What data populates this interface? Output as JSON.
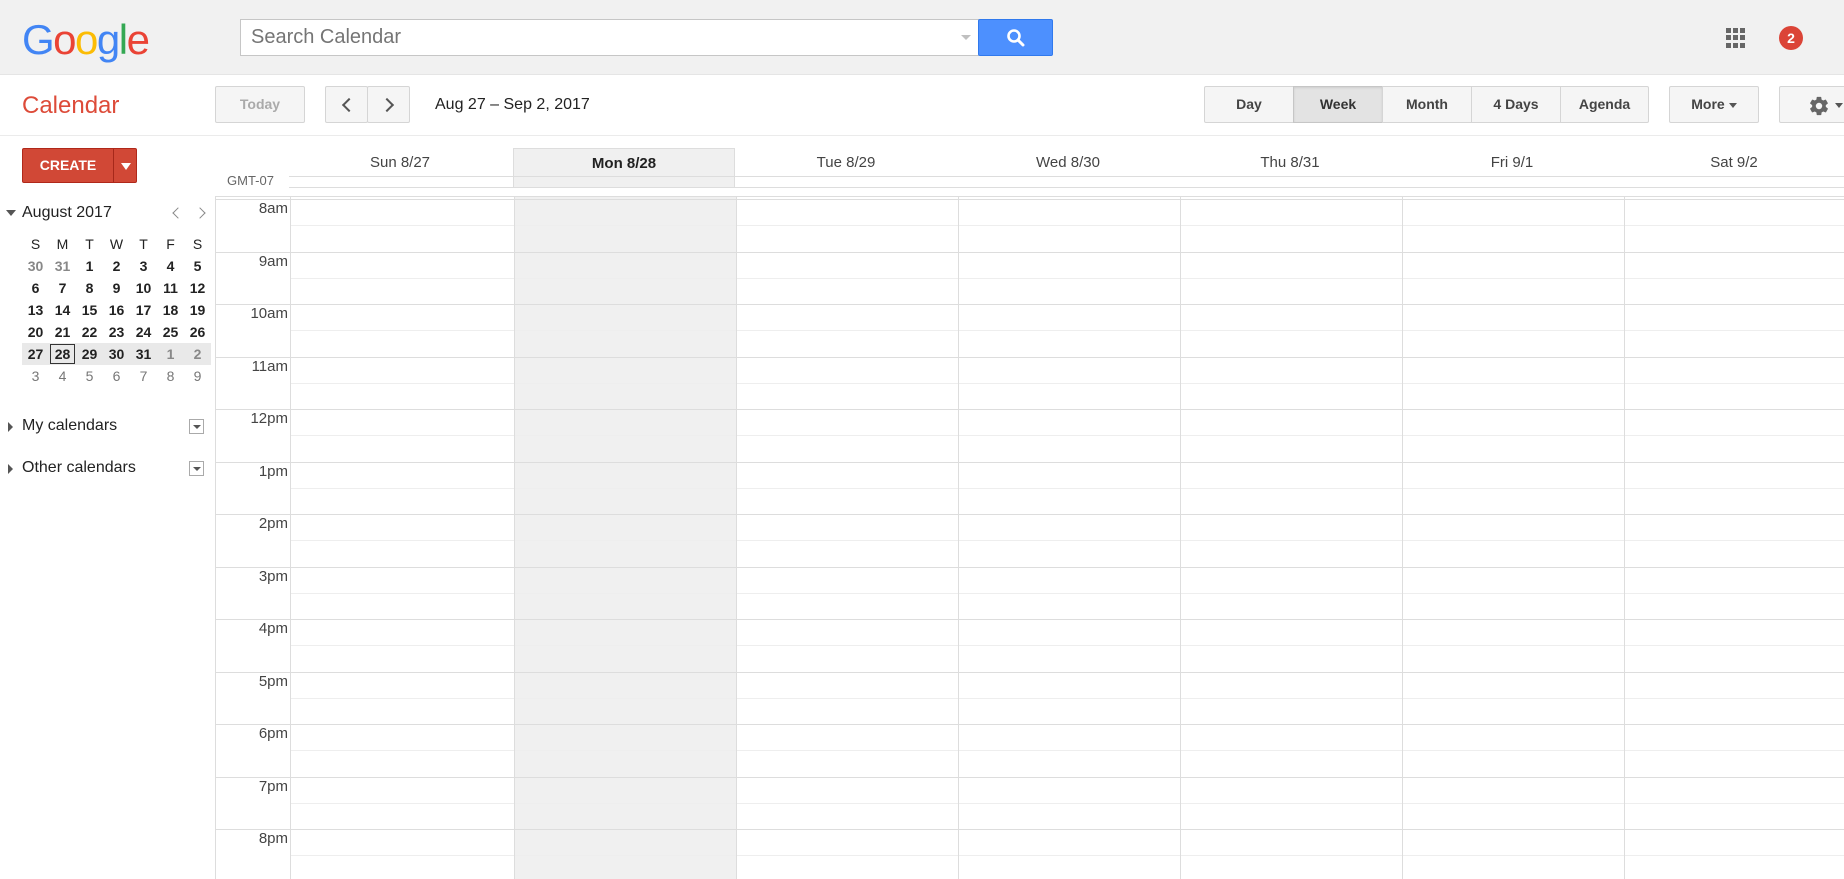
{
  "topbar": {
    "logo": [
      "G",
      "o",
      "o",
      "g",
      "l",
      "e"
    ],
    "search_placeholder": "Search Calendar",
    "notification_count": "2"
  },
  "toolbar": {
    "app_title": "Calendar",
    "today_label": "Today",
    "date_range": "Aug 27 – Sep 2, 2017",
    "views": [
      "Day",
      "Week",
      "Month",
      "4 Days",
      "Agenda"
    ],
    "active_view": "Week",
    "more_label": "More"
  },
  "sidebar": {
    "create_label": "CREATE",
    "mini_calendar": {
      "month_label": "August 2017",
      "weekdays": [
        "S",
        "M",
        "T",
        "W",
        "T",
        "F",
        "S"
      ],
      "weeks": [
        [
          "30",
          "31",
          "1",
          "2",
          "3",
          "4",
          "5"
        ],
        [
          "6",
          "7",
          "8",
          "9",
          "10",
          "11",
          "12"
        ],
        [
          "13",
          "14",
          "15",
          "16",
          "17",
          "18",
          "19"
        ],
        [
          "20",
          "21",
          "22",
          "23",
          "24",
          "25",
          "26"
        ],
        [
          "27",
          "28",
          "29",
          "30",
          "31",
          "1",
          "2"
        ],
        [
          "3",
          "4",
          "5",
          "6",
          "7",
          "8",
          "9"
        ]
      ],
      "today": "28"
    },
    "sections": {
      "my_calendars": "My calendars",
      "other_calendars": "Other calendars"
    }
  },
  "calendar": {
    "timezone": "GMT-07",
    "days": [
      "Sun 8/27",
      "Mon 8/28",
      "Tue 8/29",
      "Wed 8/30",
      "Thu 8/31",
      "Fri 9/1",
      "Sat 9/2"
    ],
    "today_index": 1,
    "hours": [
      "8am",
      "9am",
      "10am",
      "11am",
      "12pm",
      "1pm",
      "2pm",
      "3pm",
      "4pm",
      "5pm",
      "6pm",
      "7pm",
      "8pm"
    ]
  },
  "colors": {
    "accent_red": "#d14836",
    "title_red": "#dd4b39",
    "search_blue": "#4d90fe",
    "notification_red": "#db4437"
  }
}
